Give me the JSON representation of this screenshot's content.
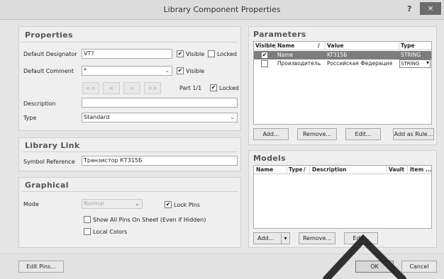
{
  "window": {
    "title": "Library Component Properties",
    "help": "?",
    "close": "×"
  },
  "properties": {
    "title": "Properties",
    "default_designator_label": "Default Designator",
    "default_designator_value": "VT?",
    "visible_label": "Visible",
    "locked_label": "Locked",
    "default_comment_label": "Default Comment",
    "default_comment_value": "*",
    "part_nav": [
      "<<",
      "<",
      ">",
      ">>"
    ],
    "part_label": "Part 1/1",
    "description_label": "Description",
    "description_value": "",
    "type_label": "Type",
    "type_value": "Standard"
  },
  "library_link": {
    "title": "Library Link",
    "symbol_reference_label": "Symbol Reference",
    "symbol_reference_value": "Транзистор КТ315Б"
  },
  "graphical": {
    "title": "Graphical",
    "mode_label": "Mode",
    "mode_value": "Normal",
    "lock_pins_label": "Lock Pins",
    "show_all_pins_label": "Show All Pins On Sheet (Even if Hidden)",
    "local_colors_label": "Local Colors"
  },
  "parameters": {
    "title": "Parameters",
    "columns": [
      "Visible",
      "Name",
      "/",
      "Value",
      "Type"
    ],
    "rows": [
      {
        "name": "Name",
        "value": "KT315Б",
        "type": "STRING",
        "checked": true
      },
      {
        "name": "Производитель",
        "value": "Российская Федерация",
        "type": "STRING",
        "checked": false
      }
    ],
    "buttons": [
      "Add...",
      "Remove...",
      "Edit...",
      "Add as Rule..."
    ]
  },
  "models": {
    "title": "Models",
    "columns": [
      "Name",
      "Type",
      "/",
      "Description",
      "Vault",
      "Item ..."
    ],
    "buttons": [
      "Add...",
      "Remove...",
      "Edit..."
    ]
  },
  "footer": {
    "edit_pins": "Edit Pins...",
    "ok": "OK",
    "cancel": "Cancel"
  },
  "icons": {
    "check": "✔",
    "dropdown": "chevron-down-icon"
  }
}
